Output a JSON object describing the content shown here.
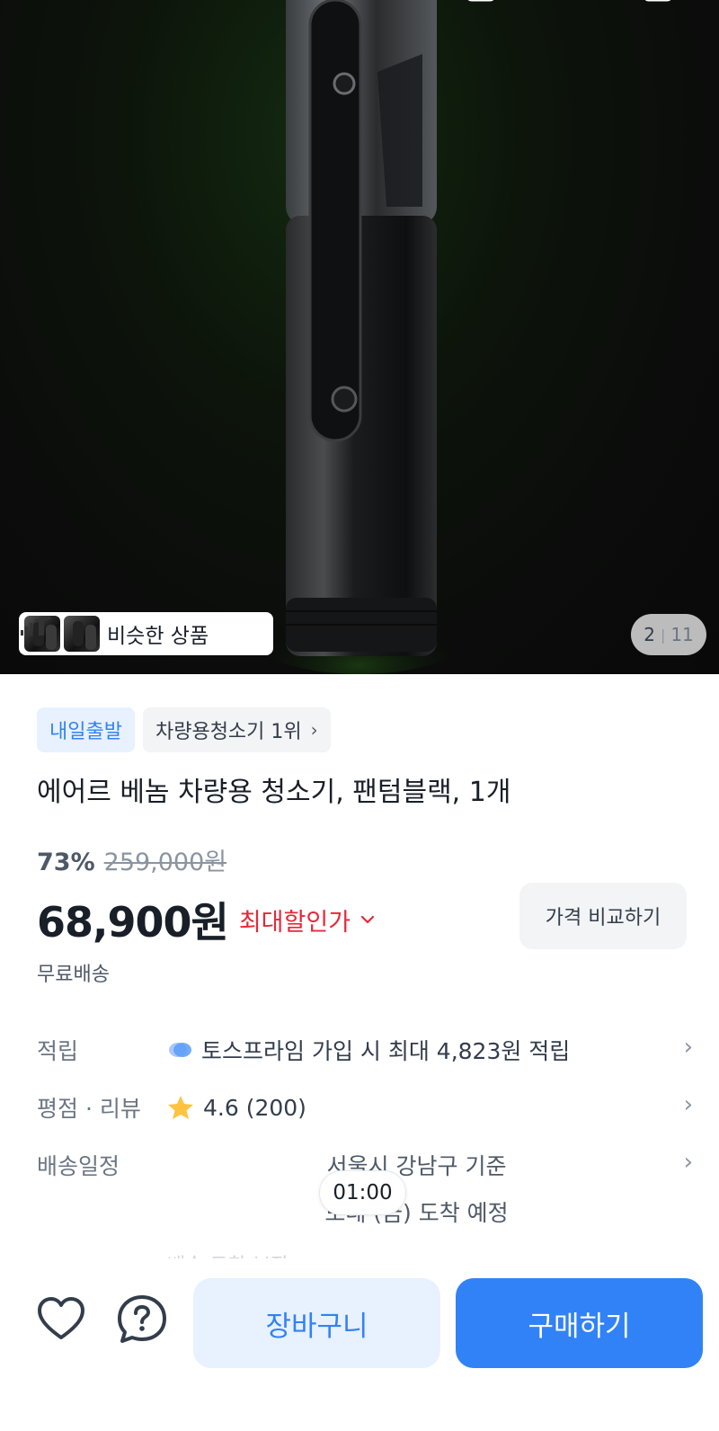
{
  "hero": {
    "similar_label": "비슷한 상품",
    "counter_current": "2",
    "counter_separator": "|",
    "counter_total": "11"
  },
  "badges": {
    "ship_tomorrow": "내일출발",
    "ranking": "차량용청소기 1위"
  },
  "product": {
    "title": "에어르 베놈 차량용 청소기, 팬텀블랙, 1개",
    "discount_percent": "73%",
    "original_price": "259,000원",
    "price": "68,900원",
    "max_discount_label": "최대할인가",
    "compare_button": "가격 비교하기",
    "shipping": "무료배송"
  },
  "info": {
    "points_label": "적립",
    "points_value": "토스프라임 가입 시 최대 4,823원 적립",
    "review_label": "평점 · 리뷰",
    "review_value": "4.6 (200)",
    "delivery_label": "배송일정",
    "delivery_line1": "서울시 강남구 기준",
    "delivery_line2": "모레 (금) 도착 예정",
    "faded_line": "배송 도착 보장"
  },
  "time_pill": "01:00",
  "actions": {
    "cart": "장바구니",
    "buy": "구매하기"
  },
  "colors": {
    "primary": "#3182f6",
    "primary_light": "#e8f1fe",
    "sale_red": "#e42939",
    "star": "#ffc342"
  }
}
